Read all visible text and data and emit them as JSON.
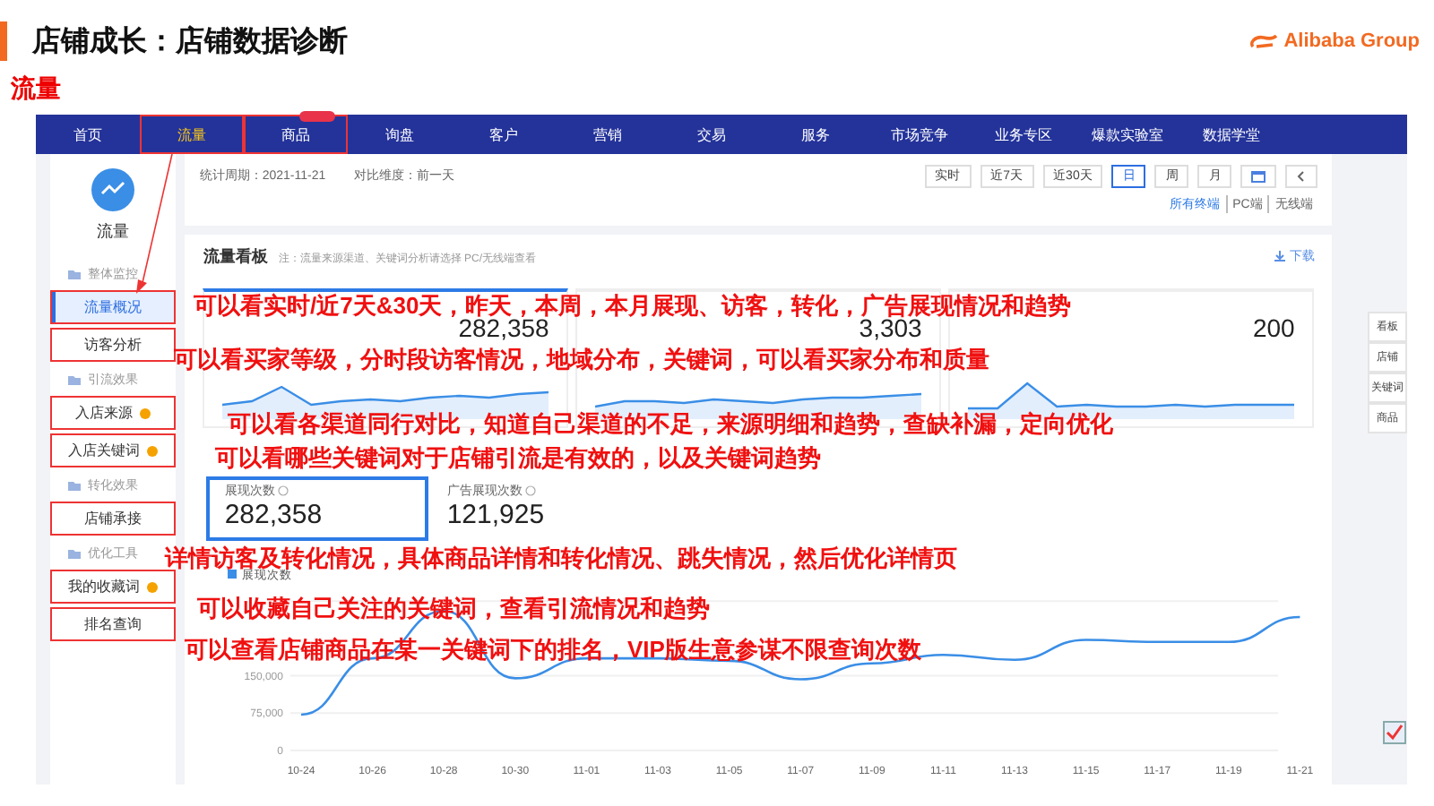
{
  "slide_title": "店铺成长：店铺数据诊断",
  "logo": "Alibaba Group",
  "section_title": "流量",
  "nav": [
    {
      "label": "首页",
      "selected": false,
      "boxed": false,
      "badge": false
    },
    {
      "label": "流量",
      "selected": true,
      "boxed": true,
      "badge": false
    },
    {
      "label": "商品",
      "selected": false,
      "boxed": true,
      "badge": true
    },
    {
      "label": "询盘",
      "selected": false,
      "boxed": false,
      "badge": false
    },
    {
      "label": "客户",
      "selected": false,
      "boxed": false,
      "badge": false
    },
    {
      "label": "营销",
      "selected": false,
      "boxed": false,
      "badge": false
    },
    {
      "label": "交易",
      "selected": false,
      "boxed": false,
      "badge": false
    },
    {
      "label": "服务",
      "selected": false,
      "boxed": false,
      "badge": false
    },
    {
      "label": "市场竞争",
      "selected": false,
      "boxed": false,
      "badge": false
    },
    {
      "label": "业务专区",
      "selected": false,
      "boxed": false,
      "badge": false
    },
    {
      "label": "爆款实验室",
      "selected": false,
      "boxed": false,
      "badge": false
    },
    {
      "label": "数据学堂",
      "selected": false,
      "boxed": false,
      "badge": false
    }
  ],
  "sidebar": {
    "title": "流量",
    "items": [
      {
        "kind": "section",
        "label": "整体监控"
      },
      {
        "kind": "item",
        "label": "流量概况",
        "selected": true,
        "boxed": true,
        "dot": false
      },
      {
        "kind": "item",
        "label": "访客分析",
        "selected": false,
        "boxed": true,
        "dot": false
      },
      {
        "kind": "section",
        "label": "引流效果"
      },
      {
        "kind": "item",
        "label": "入店来源",
        "selected": false,
        "boxed": true,
        "dot": true
      },
      {
        "kind": "item",
        "label": "入店关键词",
        "selected": false,
        "boxed": true,
        "dot": true
      },
      {
        "kind": "section",
        "label": "转化效果"
      },
      {
        "kind": "item",
        "label": "店铺承接",
        "selected": false,
        "boxed": true,
        "dot": false
      },
      {
        "kind": "section",
        "label": "优化工具"
      },
      {
        "kind": "item",
        "label": "我的收藏词",
        "selected": false,
        "boxed": true,
        "dot": true
      },
      {
        "kind": "item",
        "label": "排名查询",
        "selected": false,
        "boxed": true,
        "dot": false
      }
    ]
  },
  "filters": {
    "period": "统计周期：2021-11-21",
    "compare": "对比维度：前一天",
    "ranges": [
      {
        "kind": "text",
        "label": "实时",
        "selected": false
      },
      {
        "kind": "text",
        "label": "近7天",
        "selected": false
      },
      {
        "kind": "text",
        "label": "近30天",
        "selected": false
      },
      {
        "kind": "text",
        "label": "日",
        "selected": true
      },
      {
        "kind": "text",
        "label": "周",
        "selected": false
      },
      {
        "kind": "text",
        "label": "月",
        "selected": false
      },
      {
        "kind": "calendar",
        "selected": false
      },
      {
        "kind": "prev",
        "selected": false
      }
    ],
    "terminals": [
      {
        "label": "所有终端",
        "selected": true
      },
      {
        "label": "PC端",
        "selected": false
      },
      {
        "label": "无线端",
        "selected": false
      }
    ]
  },
  "panel": {
    "title": "流量看板",
    "note": "注：流量来源渠道、关键词分析请选择 PC/无线端查看",
    "download": "下载",
    "metrics": [
      {
        "value": "282,358"
      },
      {
        "value": "3,303"
      },
      {
        "value": "200"
      }
    ],
    "indicators": [
      {
        "label": "展现次数",
        "value": "282,358",
        "selected": true
      },
      {
        "label": "广告展现次数",
        "value": "121,925",
        "selected": false
      }
    ],
    "chart_data": {
      "type": "line",
      "categories": [
        "10-24",
        "10-26",
        "10-28",
        "10-30",
        "11-01",
        "11-03",
        "11-05",
        "11-07",
        "11-09",
        "11-11",
        "11-13",
        "11-15",
        "11-17",
        "11-19",
        "11-21"
      ],
      "series": [
        {
          "name": "展现次数",
          "color": "#3a8ee6",
          "values": [
            72000,
            185000,
            280000,
            145000,
            185000,
            185000,
            180000,
            143000,
            175000,
            192000,
            182000,
            222000,
            218000,
            218000,
            268000
          ]
        }
      ],
      "ylim": [
        0,
        300000
      ],
      "yticks": [
        {
          "value": 0,
          "label": "0"
        },
        {
          "value": 75000,
          "label": "75,000"
        },
        {
          "value": 150000,
          "label": "150,000"
        }
      ]
    }
  },
  "right_rail": [
    "看板",
    "店铺",
    "关键词",
    "商品"
  ],
  "annotations": [
    "可以看实时/近7天&30天，昨天，本周，本月展现、访客，转化，广告展现情况和趋势",
    "可以看买家等级，分时段访客情况，地域分布，关键词，可以看买家分布和质量",
    "可以看各渠道同行对比，知道自己渠道的不足，来源明细和趋势，查缺补漏，定向优化",
    "可以看哪些关键词对于店铺引流是有效的，以及关键词趋势",
    "详情访客及转化情况，具体商品详情和转化情况、跳失情况，然后优化详情页",
    "可以收藏自己关注的关键词，查看引流情况和趋势",
    "可以查看店铺商品在某一关键词下的排名，VIP版生意参谋不限查询次数"
  ]
}
